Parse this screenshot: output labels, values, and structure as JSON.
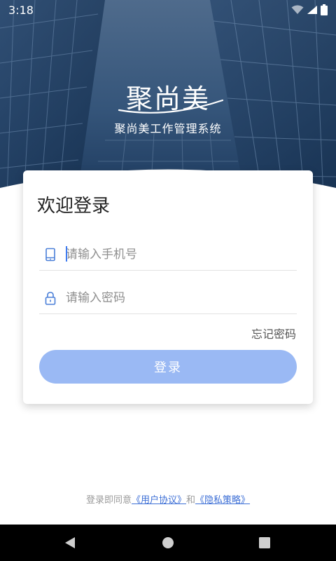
{
  "status_bar": {
    "time": "3:18",
    "icons": [
      "wifi-icon",
      "signal-icon",
      "battery-icon"
    ]
  },
  "header": {
    "logo_text": "聚尚美",
    "app_subtitle": "聚尚美工作管理系统"
  },
  "login_card": {
    "title": "欢迎登录",
    "phone_placeholder": "请输入手机号",
    "phone_icon": "phone-icon",
    "password_placeholder": "请输入密码",
    "password_icon": "lock-icon",
    "forgot_password_label": "忘记密码",
    "login_button_label": "登录"
  },
  "agreement": {
    "prefix": "登录即同意",
    "user_agreement_label": "《用户协议》",
    "conjunction": "和",
    "privacy_policy_label": "《隐私策略》"
  },
  "nav_bar": {
    "buttons": [
      "back-icon",
      "home-icon",
      "recents-icon"
    ]
  },
  "colors": {
    "accent": "#3f7cf0",
    "button_disabled": "#9ab9f4",
    "hero_dark": "#1f3a5c",
    "link": "#3d6fd6"
  }
}
